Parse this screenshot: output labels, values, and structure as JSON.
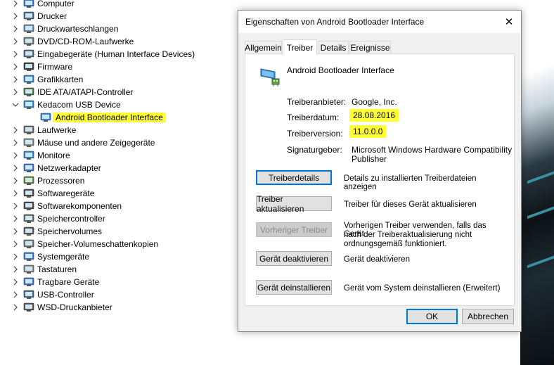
{
  "tree": {
    "items": [
      {
        "label": "Computer",
        "expanded": false,
        "icon": "computer-icon"
      },
      {
        "label": "Drucker",
        "expanded": false,
        "icon": "printer-icon"
      },
      {
        "label": "Druckwarteschlangen",
        "expanded": false,
        "icon": "print-queue-icon"
      },
      {
        "label": "DVD/CD-ROM-Laufwerke",
        "expanded": false,
        "icon": "dvd-drive-icon"
      },
      {
        "label": "Eingabegeräte (Human Interface Devices)",
        "expanded": false,
        "icon": "hid-icon"
      },
      {
        "label": "Firmware",
        "expanded": false,
        "icon": "firmware-icon"
      },
      {
        "label": "Grafikkarten",
        "expanded": false,
        "icon": "display-adapter-icon"
      },
      {
        "label": "IDE ATA/ATAPI-Controller",
        "expanded": false,
        "icon": "ide-controller-icon"
      },
      {
        "label": "Kedacom USB Device",
        "expanded": true,
        "icon": "usb-device-icon"
      },
      {
        "label": "Android Bootloader Interface",
        "child": true,
        "selected": true,
        "icon": "android-device-icon"
      },
      {
        "label": "Laufwerke",
        "expanded": false,
        "icon": "disk-drive-icon"
      },
      {
        "label": "Mäuse und andere Zeigegeräte",
        "expanded": false,
        "icon": "mouse-icon"
      },
      {
        "label": "Monitore",
        "expanded": false,
        "icon": "monitor-icon"
      },
      {
        "label": "Netzwerkadapter",
        "expanded": false,
        "icon": "network-adapter-icon"
      },
      {
        "label": "Prozessoren",
        "expanded": false,
        "icon": "processor-icon"
      },
      {
        "label": "Softwaregeräte",
        "expanded": false,
        "icon": "software-device-icon"
      },
      {
        "label": "Softwarekomponenten",
        "expanded": false,
        "icon": "software-component-icon"
      },
      {
        "label": "Speichercontroller",
        "expanded": false,
        "icon": "storage-controller-icon"
      },
      {
        "label": "Speichervolumes",
        "expanded": false,
        "icon": "storage-volume-icon"
      },
      {
        "label": "Speicher-Volumeschattenkopien",
        "expanded": false,
        "icon": "shadow-copy-icon"
      },
      {
        "label": "Systemgeräte",
        "expanded": false,
        "icon": "system-device-icon"
      },
      {
        "label": "Tastaturen",
        "expanded": false,
        "icon": "keyboard-icon"
      },
      {
        "label": "Tragbare Geräte",
        "expanded": false,
        "icon": "portable-device-icon"
      },
      {
        "label": "USB-Controller",
        "expanded": false,
        "icon": "usb-controller-icon"
      },
      {
        "label": "WSD-Druckanbieter",
        "expanded": false,
        "icon": "wsd-printer-icon"
      }
    ]
  },
  "dialog": {
    "title": "Eigenschaften von Android Bootloader Interface",
    "close_glyph": "✕",
    "tabs": [
      {
        "label": "Allgemein",
        "active": false
      },
      {
        "label": "Treiber",
        "active": true
      },
      {
        "label": "Details",
        "active": false
      },
      {
        "label": "Ereignisse",
        "active": false
      }
    ],
    "device_name": "Android Bootloader Interface",
    "properties": {
      "provider_label": "Treiberanbieter:",
      "provider_value": "Google, Inc.",
      "date_label": "Treiberdatum:",
      "date_value": "28.08.2016",
      "version_label": "Treiberversion:",
      "version_value": "11.0.0.0",
      "signer_label": "Signaturgeber:",
      "signer_value_line1": "Microsoft Windows Hardware Compatibility",
      "signer_value_line2": "Publisher"
    },
    "actions": [
      {
        "label": "Treiberdetails",
        "desc": "Details zu installierten Treiberdateien anzeigen",
        "enabled": true
      },
      {
        "label": "Treiber aktualisieren",
        "desc": "Treiber für dieses Gerät aktualisieren",
        "enabled": true
      },
      {
        "label": "Vorheriger Treiber",
        "desc_line1": "Vorherigen Treiber verwenden, falls das Gerät",
        "desc_line2": "nach der Treiberaktualisierung nicht",
        "desc_line3": "ordnungsgemäß funktioniert.",
        "enabled": false
      },
      {
        "label": "Gerät deaktivieren",
        "desc": "Gerät deaktivieren",
        "enabled": true
      },
      {
        "label": "Gerät deinstallieren",
        "desc": "Gerät vom System deinstallieren (Erweitert)",
        "enabled": true
      }
    ],
    "ok_label": "OK",
    "cancel_label": "Abbrechen"
  },
  "colors": {
    "highlight": "#ffff33",
    "focus_border": "#0078d7"
  }
}
